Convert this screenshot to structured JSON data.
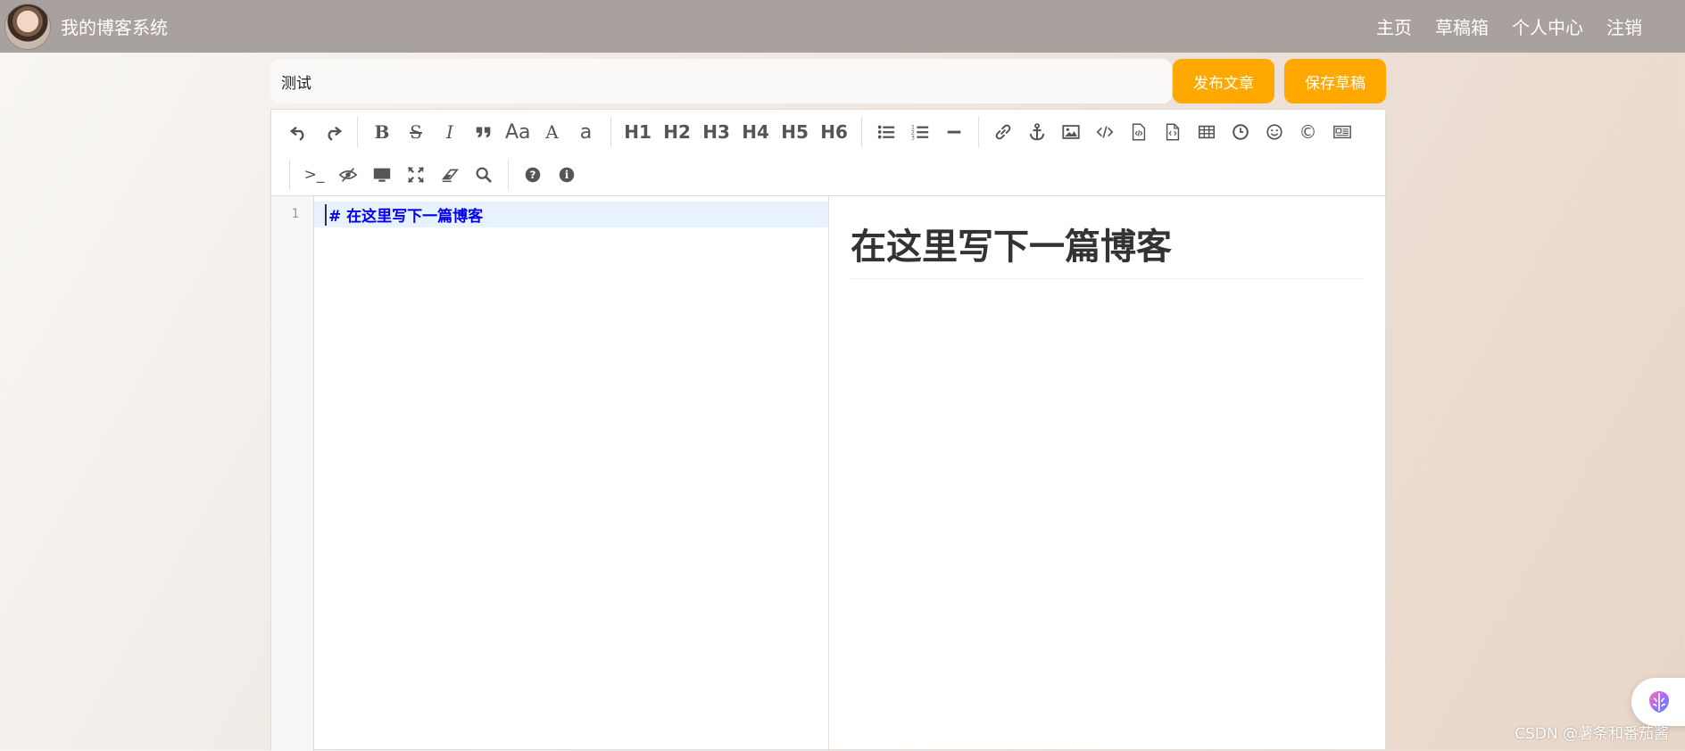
{
  "nav": {
    "brand": "我的博客系统",
    "links": [
      "主页",
      "草稿箱",
      "个人中心",
      "注销"
    ]
  },
  "editor_header": {
    "title_value": "测试",
    "publish_label": "发布文章",
    "save_draft_label": "保存草稿"
  },
  "toolbar": {
    "row1": [
      "undo-icon",
      "redo-icon",
      "bold-icon",
      "strikethrough-icon",
      "italic-icon",
      "quote-icon",
      "uppercase-icon",
      "title-case-icon",
      "lowercase-icon",
      "H1",
      "H2",
      "H3",
      "H4",
      "H5",
      "H6",
      "unordered-list-icon",
      "ordered-list-icon",
      "horizontal-rule-icon",
      "link-icon",
      "anchor-icon",
      "image-icon",
      "code-icon",
      "preformatted-code-icon",
      "code-block-icon",
      "table-icon",
      "datetime-icon",
      "emoji-icon",
      "html-entities-icon",
      "pagebreak-icon"
    ],
    "row2": [
      "goto-line-icon",
      "watch-icon",
      "preview-icon",
      "fullscreen-icon",
      "clear-icon",
      "search-icon",
      "help-icon",
      "info-icon"
    ],
    "labels": {
      "aa_upper": "Aa",
      "a_title": "A",
      "a_lower": "a",
      "h1": "H1",
      "h2": "H2",
      "h3": "H3",
      "h4": "H4",
      "h5": "H5",
      "h6": "H6",
      "bold": "B",
      "strike": "S",
      "italic": "I",
      "goto": ">_",
      "copyright": "©"
    }
  },
  "code": {
    "line_number": "1",
    "line_text": "# 在这里写下一篇博客"
  },
  "preview": {
    "heading": "在这里写下一篇博客"
  },
  "watermark": "CSDN @薯条和番茄酱",
  "colors": {
    "nav_bg": "#a8a19d",
    "accent": "#ffa800",
    "code_highlight": "#e8f2ff",
    "code_text": "#0000ee"
  }
}
